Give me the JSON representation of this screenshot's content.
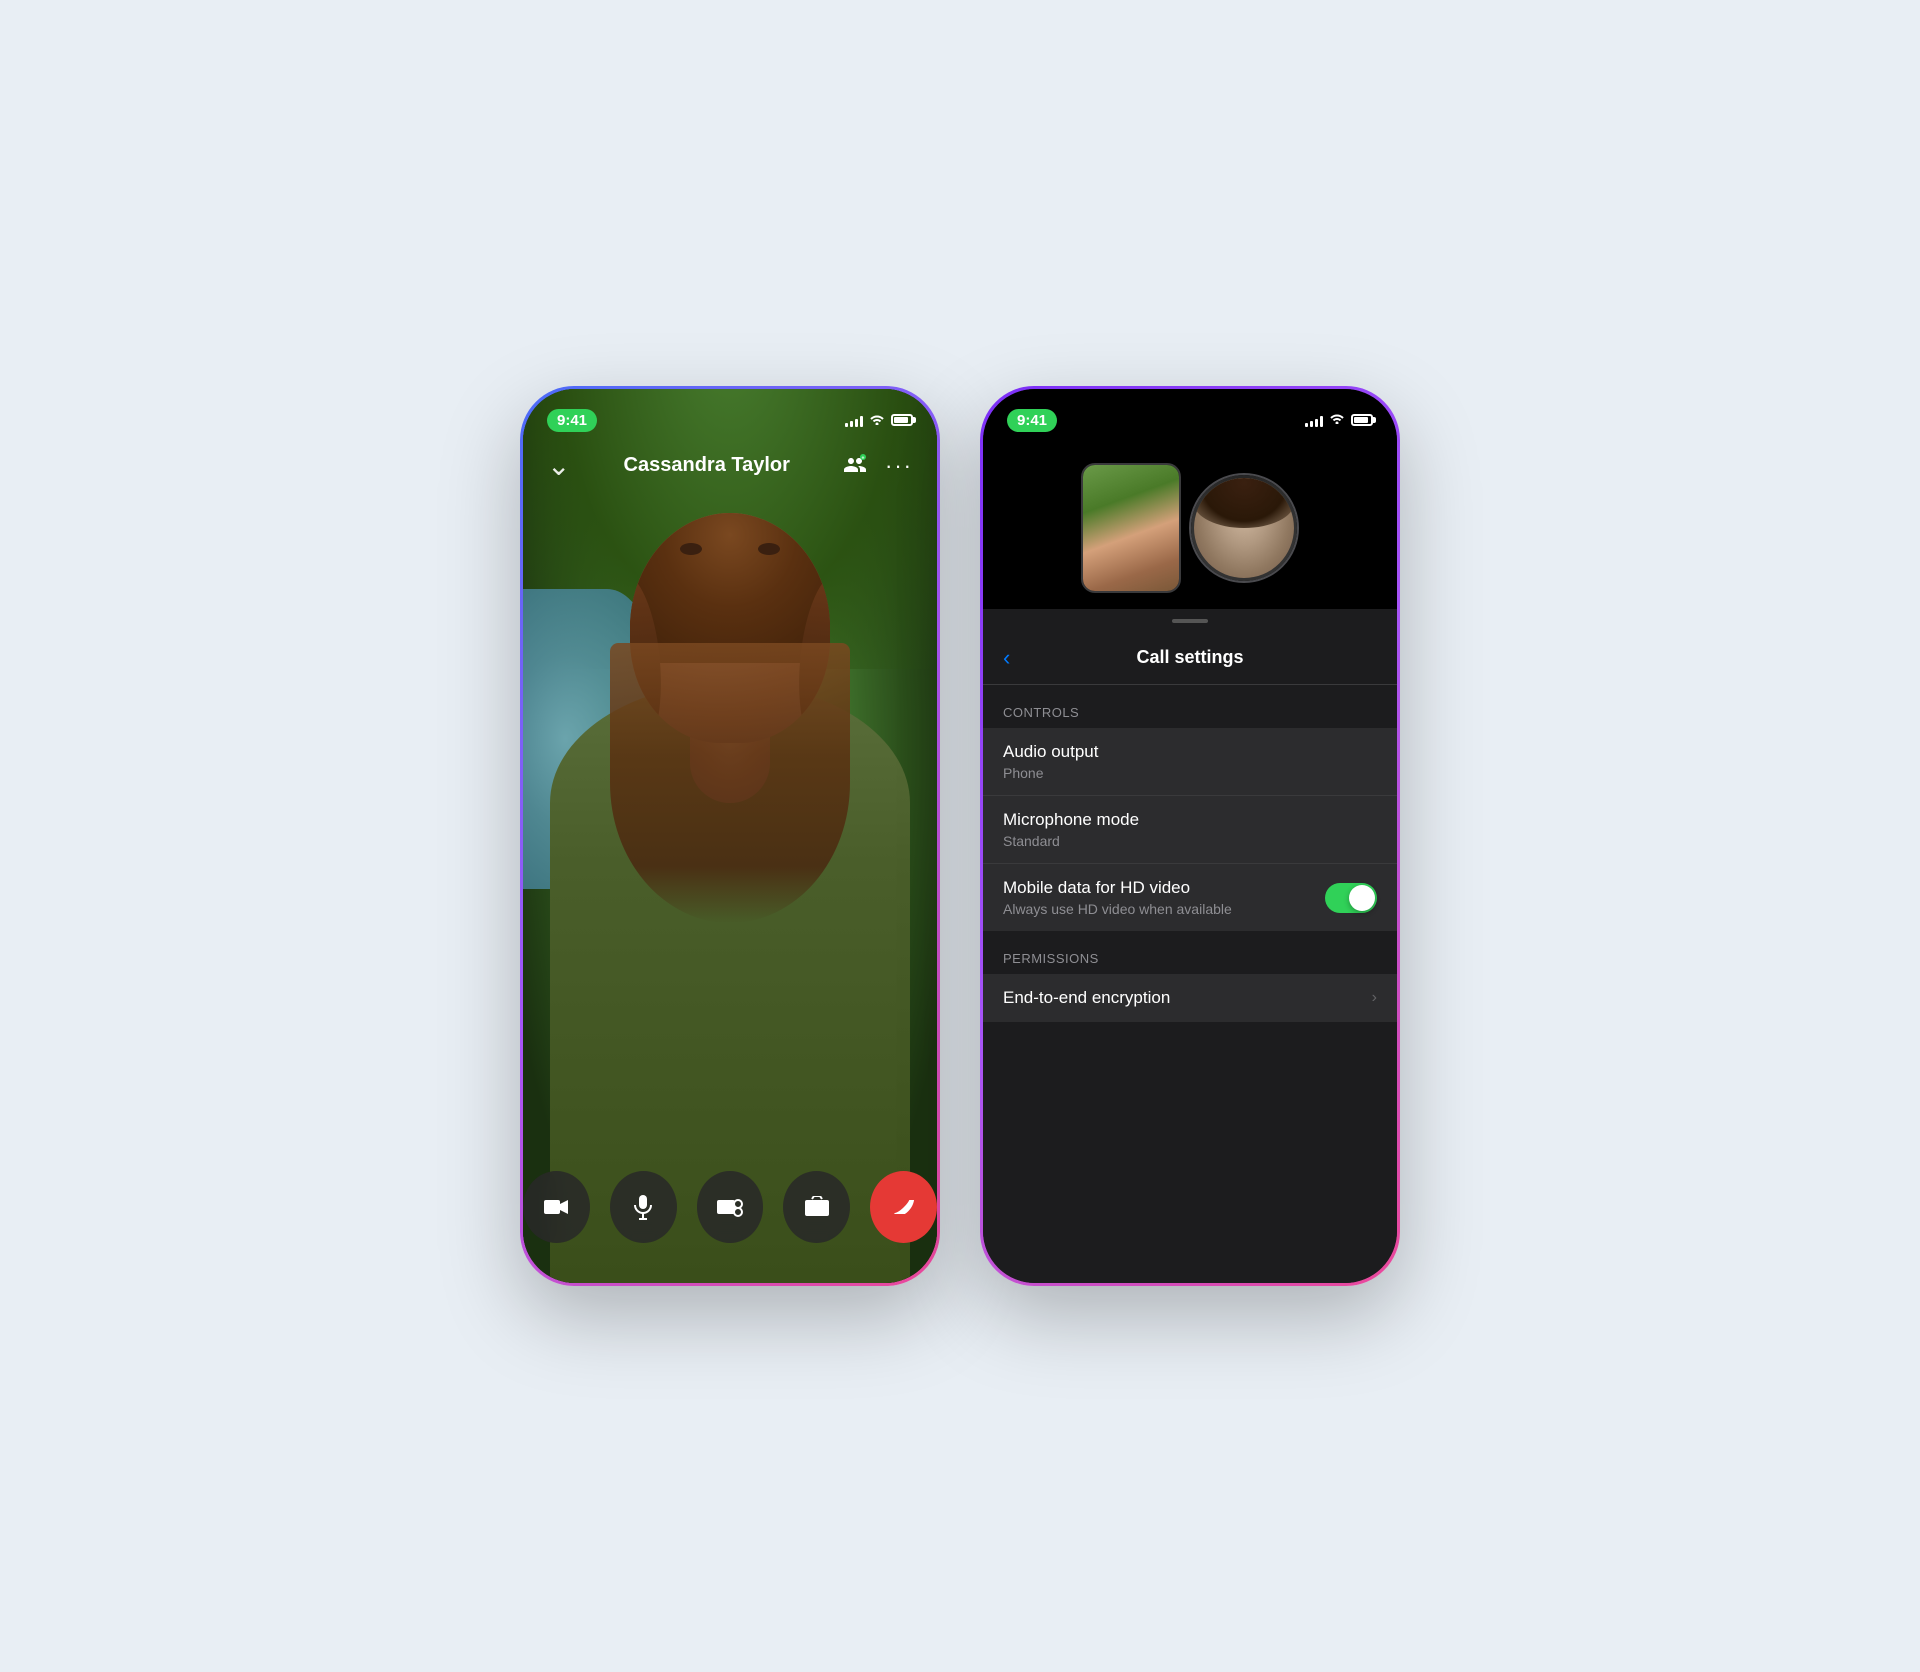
{
  "page": {
    "background_color": "#e8eef4"
  },
  "left_phone": {
    "status": {
      "time": "9:41",
      "signal": [
        3,
        5,
        7,
        9,
        11
      ],
      "wifi": "wifi",
      "battery": "battery"
    },
    "call": {
      "caller_name": "Cassandra Taylor",
      "back_icon": "‹",
      "add_person_icon": "+👤",
      "more_icon": "···"
    },
    "controls": {
      "video_icon": "📹",
      "mic_icon": "🎙",
      "effects_icon": "🎮",
      "flip_icon": "📷",
      "end_call_icon": "📞"
    }
  },
  "right_phone": {
    "status": {
      "time": "9:41",
      "signal": [
        3,
        5,
        7,
        9,
        11
      ],
      "wifi": "wifi",
      "battery": "battery"
    },
    "header": {
      "back_label": "‹",
      "title": "Call settings"
    },
    "sections": [
      {
        "label": "Controls",
        "rows": [
          {
            "title": "Audio output",
            "subtitle": "Phone",
            "type": "navigation"
          },
          {
            "title": "Microphone mode",
            "subtitle": "Standard",
            "type": "navigation"
          },
          {
            "title": "Mobile data for HD video",
            "subtitle": "Always use HD video when available",
            "type": "toggle",
            "toggle_on": true
          }
        ]
      },
      {
        "label": "Permissions",
        "rows": [
          {
            "title": "End-to-end encryption",
            "subtitle": "",
            "type": "navigation"
          }
        ]
      }
    ]
  }
}
